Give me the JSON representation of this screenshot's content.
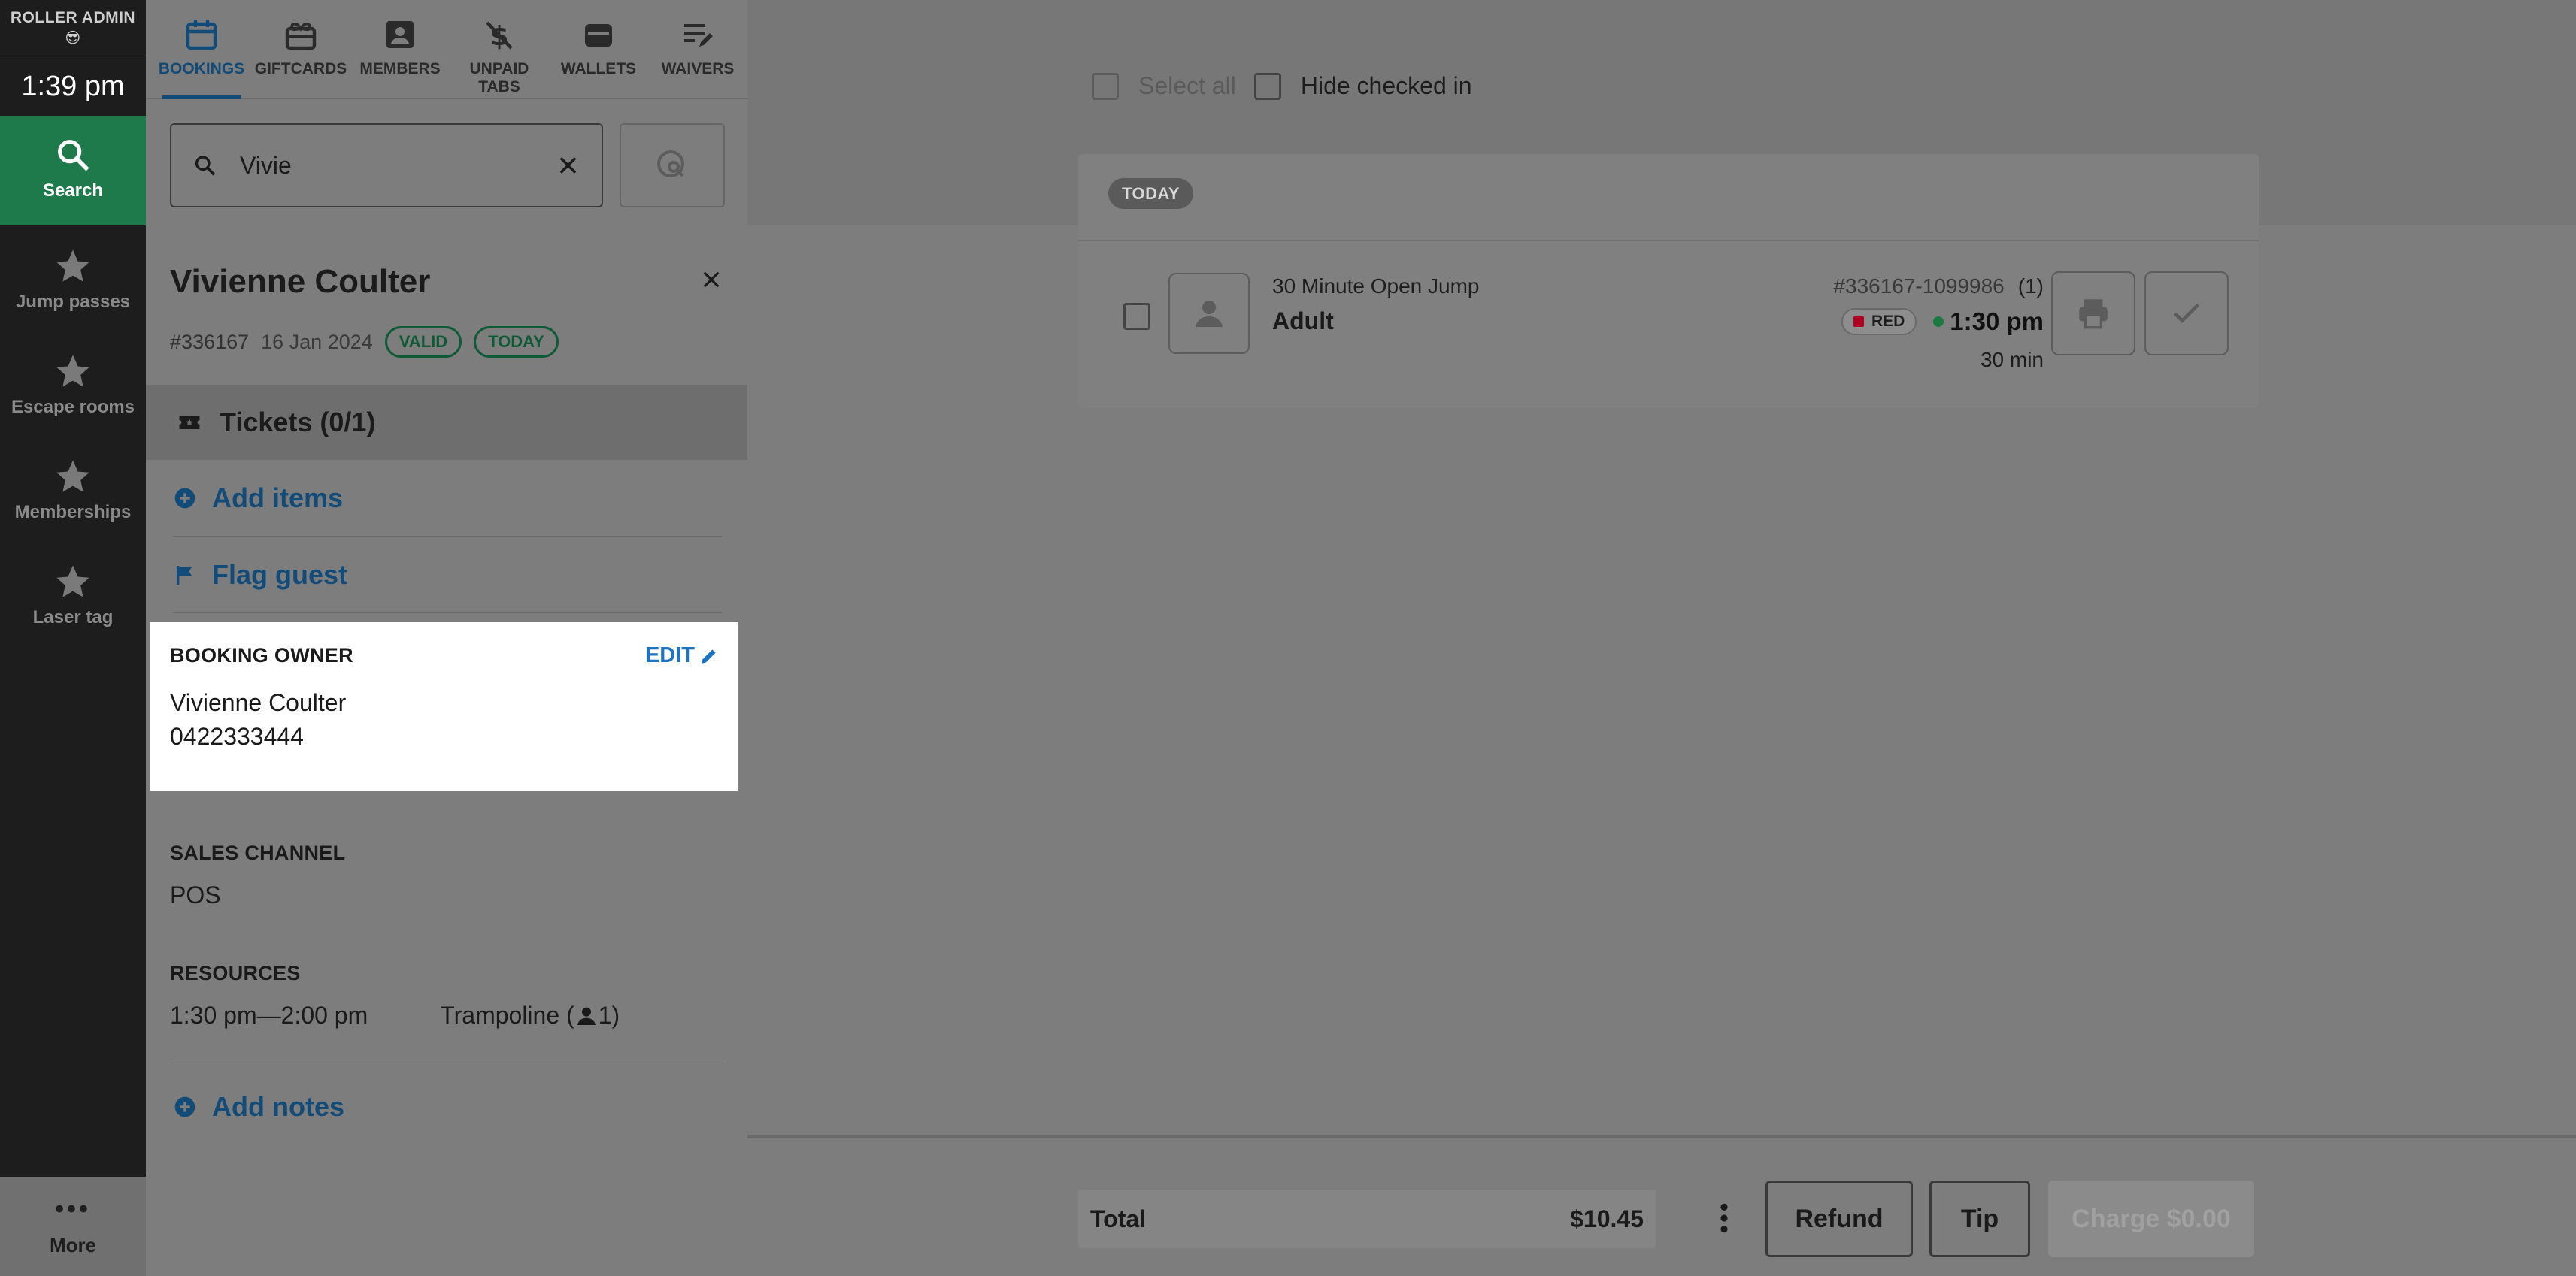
{
  "nav": {
    "brand": "ROLLER ADMIN",
    "brand_emoji": "😎",
    "clock": "1:39 pm",
    "items": [
      {
        "label": "Search",
        "icon": "search-icon"
      },
      {
        "label": "Jump passes",
        "icon": "star-icon"
      },
      {
        "label": "Escape rooms",
        "icon": "star-icon"
      },
      {
        "label": "Memberships",
        "icon": "star-icon"
      },
      {
        "label": "Laser tag",
        "icon": "star-icon"
      }
    ],
    "more": "More"
  },
  "tabs": [
    {
      "label": "BOOKINGS",
      "icon": "calendar-icon",
      "active": true
    },
    {
      "label": "GIFTCARDS",
      "icon": "gift-card-icon"
    },
    {
      "label": "MEMBERS",
      "icon": "member-card-icon"
    },
    {
      "label": "UNPAID TABS",
      "icon": "unpaid-tab-icon"
    },
    {
      "label": "WALLETS",
      "icon": "wallet-icon"
    },
    {
      "label": "WAIVERS",
      "icon": "waiver-icon"
    }
  ],
  "search": {
    "value": "Vivie"
  },
  "guest": {
    "name": "Vivienne Coulter",
    "booking_id": "#336167",
    "date": "16 Jan 2024",
    "badges": [
      "VALID",
      "TODAY"
    ]
  },
  "tickets": {
    "label": "Tickets (0/1)"
  },
  "actions": {
    "add_items": "Add items",
    "flag_guest": "Flag guest",
    "add_notes": "Add notes"
  },
  "owner": {
    "title": "BOOKING OWNER",
    "edit": "EDIT",
    "name": "Vivienne Coulter",
    "phone": "0422333444"
  },
  "sales_channel": {
    "label": "SALES CHANNEL",
    "value": "POS"
  },
  "resources": {
    "label": "RESOURCES",
    "time": "1:30 pm—2:00 pm",
    "name": "Trampoline (",
    "count": "1)"
  },
  "filters": {
    "select_all": "Select all",
    "hide_checked_in": "Hide checked in"
  },
  "booking_card": {
    "day": "TODAY",
    "product": "30 Minute Open Jump",
    "ticket_type": "Adult",
    "ref": "#336167-1099986",
    "qty": "(1)",
    "tag": "RED",
    "tag_color": "#b00020",
    "time": "1:30 pm",
    "status_color": "#1a7a40",
    "duration": "30 min"
  },
  "footer": {
    "total_label": "Total",
    "total_value": "$10.45",
    "refund": "Refund",
    "tip": "Tip",
    "charge": "Charge $0.00"
  },
  "colors": {
    "accent": "#1b74c7",
    "active_nav": "#1e7a4b",
    "valid": "#0f5a36"
  }
}
